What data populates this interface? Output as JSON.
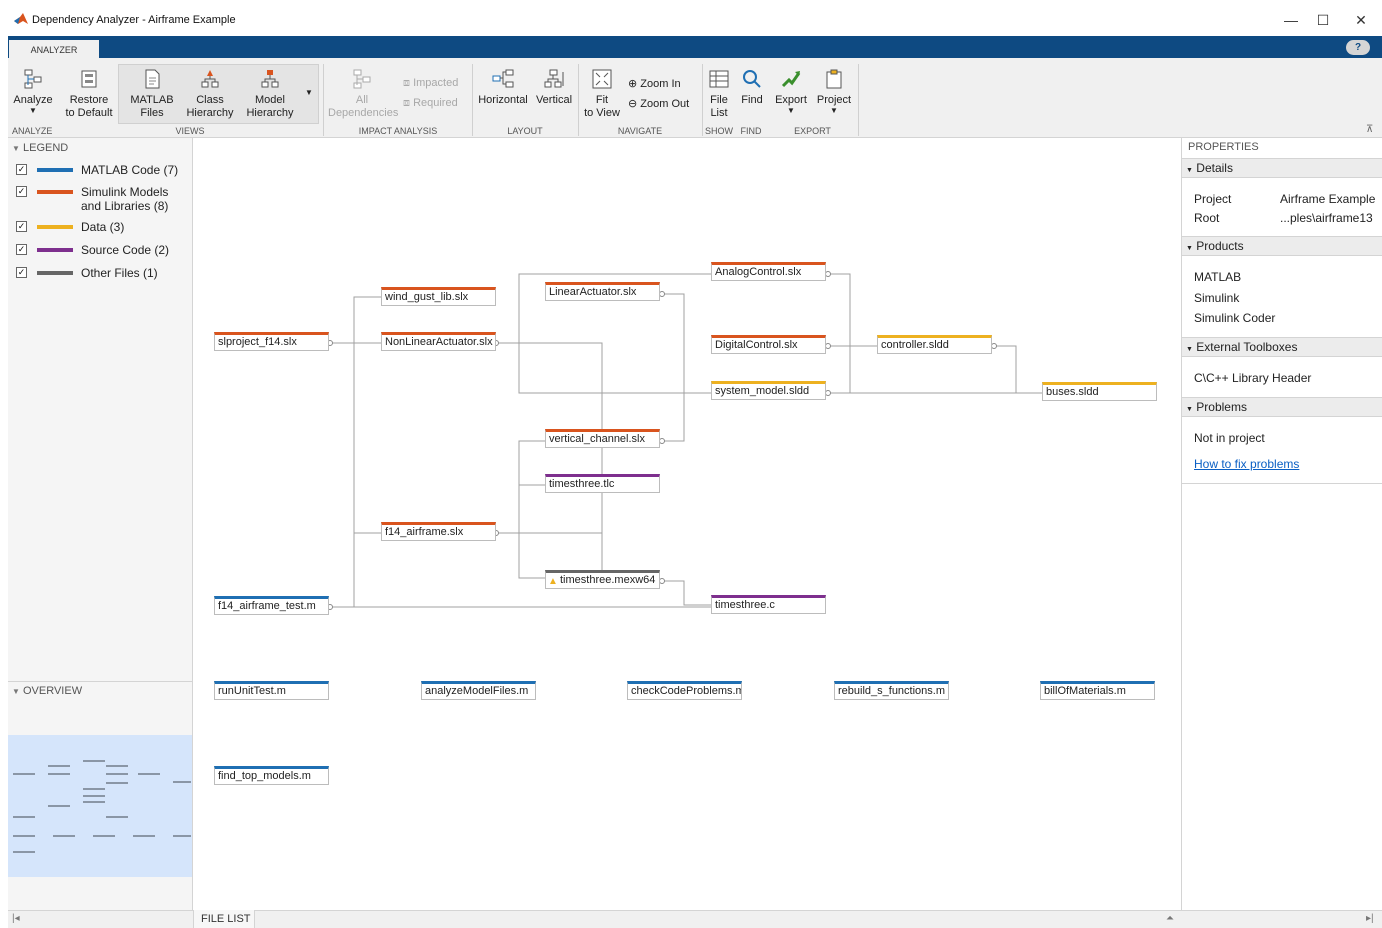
{
  "window": {
    "title": "Dependency Analyzer - Airframe Example",
    "minimize": "—",
    "maximize": "☐",
    "close": "✕"
  },
  "tabs": [
    "ANALYZER"
  ],
  "help_label": "?",
  "toolstrip": {
    "analyze": "Analyze",
    "restore_line1": "Restore",
    "restore_line2": "to Default",
    "matlab_files_line1": "MATLAB",
    "matlab_files_line2": "Files",
    "class_hierarchy_line1": "Class",
    "class_hierarchy_line2": "Hierarchy",
    "model_hierarchy_line1": "Model",
    "model_hierarchy_line2": "Hierarchy",
    "all_dependencies_line1": "All",
    "all_dependencies_line2": "Dependencies",
    "impacted": "Impacted",
    "required": "Required",
    "horizontal": "Horizontal",
    "vertical": "Vertical",
    "fit_line1": "Fit",
    "fit_line2": "to View",
    "zoom_in": "Zoom In",
    "zoom_out": "Zoom Out",
    "file_list_line1": "File",
    "file_list_line2": "List",
    "find": "Find",
    "export": "Export",
    "project": "Project",
    "sections": {
      "analyze": "ANALYZE",
      "views": "VIEWS",
      "impact": "IMPACT ANALYSIS",
      "layout": "LAYOUT",
      "navigate": "NAVIGATE",
      "show": "SHOW",
      "find": "FIND",
      "export": "EXPORT"
    }
  },
  "legend": {
    "header": "LEGEND",
    "items": [
      {
        "label": "MATLAB Code (7)",
        "color": "#1f6fb3",
        "checked": true
      },
      {
        "label": "Simulink Models and Libraries (8)",
        "color": "#d9541e",
        "checked": true
      },
      {
        "label": "Data (3)",
        "color": "#edb120",
        "checked": true
      },
      {
        "label": "Source Code (2)",
        "color": "#7e2f8e",
        "checked": true
      },
      {
        "label": "Other Files (1)",
        "color": "#666666",
        "checked": true
      }
    ]
  },
  "overview": {
    "header": "OVERVIEW"
  },
  "graph": {
    "nodes": {
      "slproject": "slproject_f14.slx",
      "wind_gust": "wind_gust_lib.slx",
      "nonlinear": "NonLinearActuator.slx",
      "linear": "LinearActuator.slx",
      "analog": "AnalogControl.slx",
      "digital": "DigitalControl.slx",
      "system_model": "system_model.sldd",
      "controller": "controller.sldd",
      "buses": "buses.sldd",
      "vertical_channel": "vertical_channel.slx",
      "timesthree_tlc": "timesthree.tlc",
      "f14_airframe": "f14_airframe.slx",
      "timesthree_mex": "timesthree.mexw64",
      "f14_test": "f14_airframe_test.m",
      "timesthree_c": "timesthree.c",
      "run_unit": "runUnitTest.m",
      "analyze_model": "analyzeModelFiles.m",
      "check_code": "checkCodeProblems.m",
      "rebuild": "rebuild_s_functions.m",
      "bill": "billOfMaterials.m",
      "find_top": "find_top_models.m"
    }
  },
  "properties": {
    "title": "PROPERTIES",
    "details": {
      "header": "Details",
      "project_label": "Project",
      "project_value": "Airframe Example",
      "root_label": "Root",
      "root_value": "...ples\\airframe13"
    },
    "products": {
      "header": "Products",
      "items": [
        "MATLAB",
        "Simulink",
        "Simulink Coder"
      ]
    },
    "toolboxes": {
      "header": "External Toolboxes",
      "items": [
        "C\\C++ Library Header"
      ]
    },
    "problems": {
      "header": "Problems",
      "status": "Not in project",
      "link": "How to fix problems"
    }
  },
  "bottom": {
    "file_list": "FILE LIST"
  }
}
